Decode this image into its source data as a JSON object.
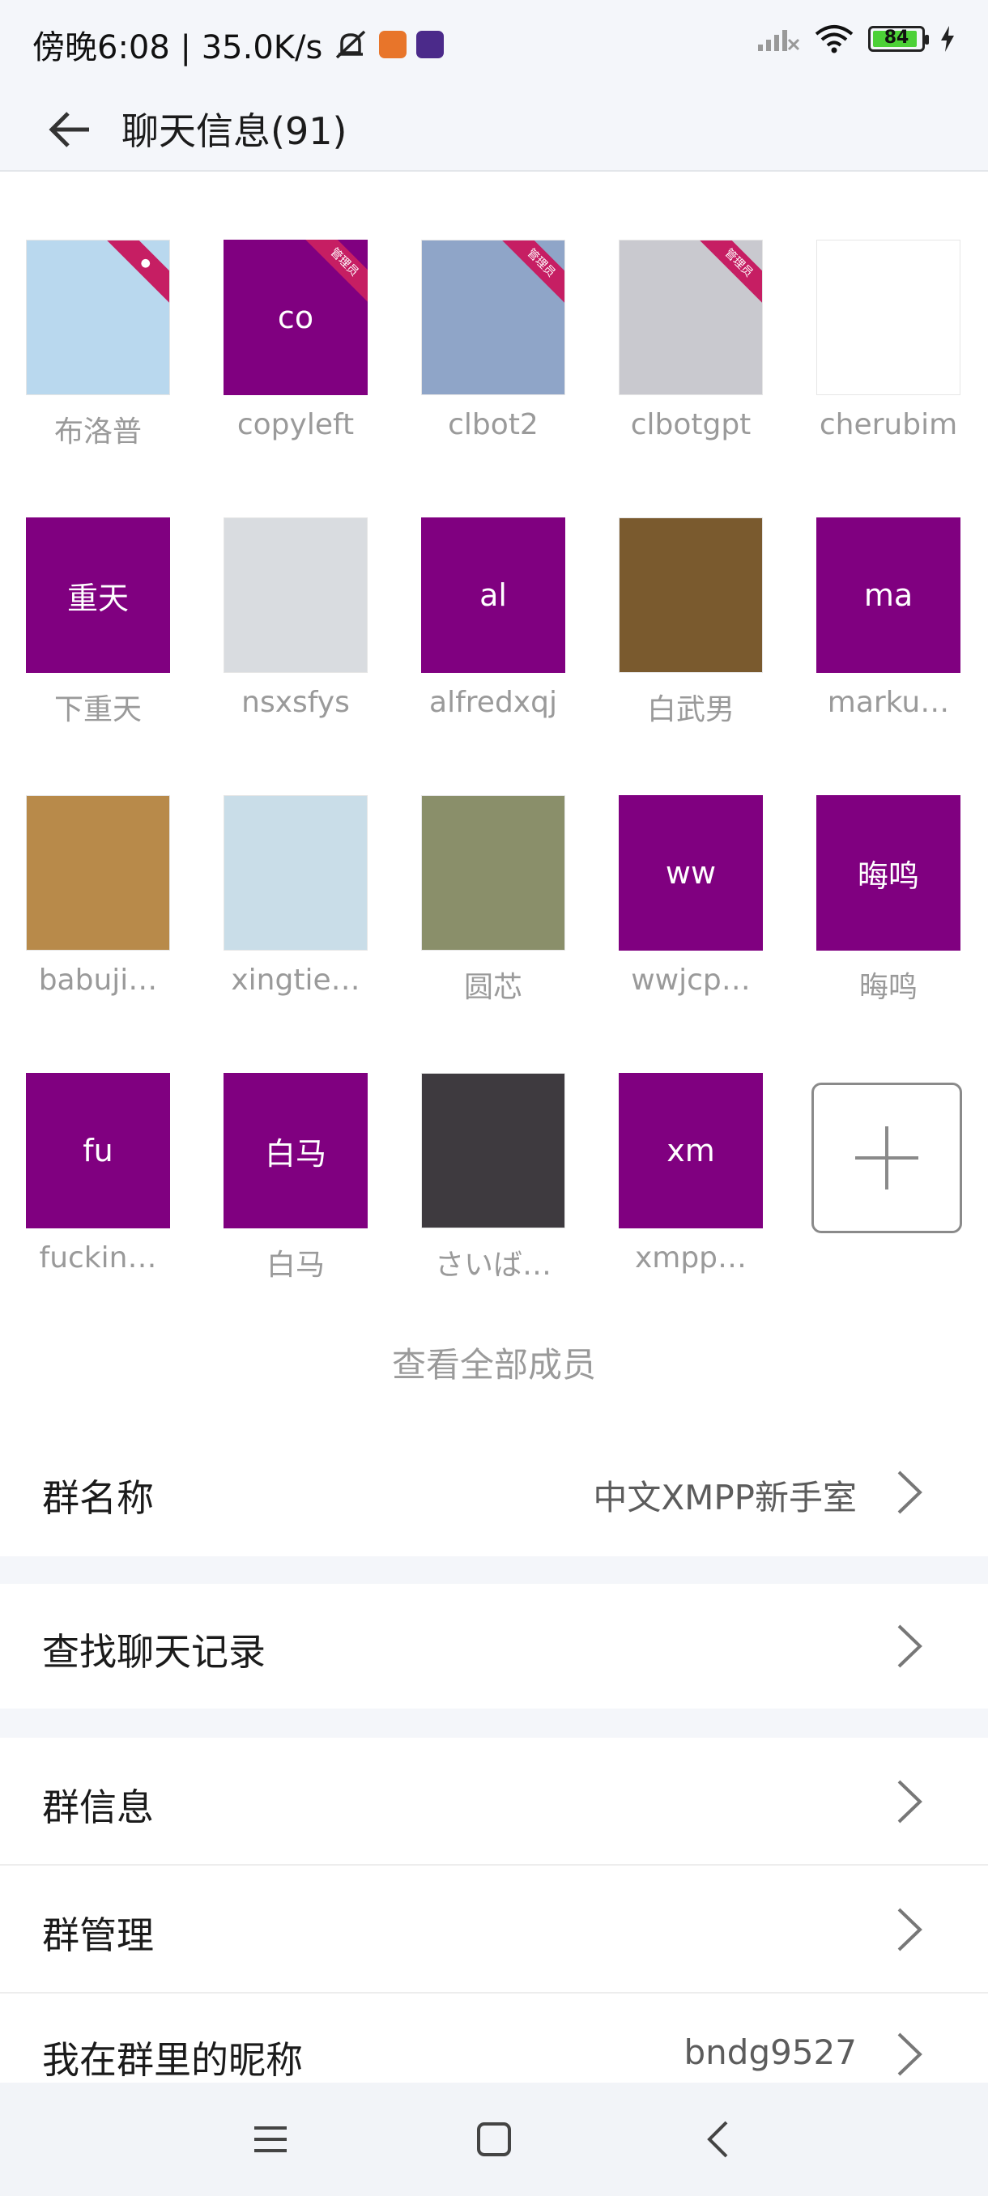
{
  "status": {
    "time_speed": "傍晚6:08 | 35.0K/s",
    "battery": "84"
  },
  "header": {
    "title": "聊天信息(91)"
  },
  "members": [
    {
      "name": "布洛普",
      "avatar_text": "",
      "style": "image",
      "color": "#b9d8ee",
      "badge": "person"
    },
    {
      "name": "copyleft",
      "avatar_text": "co",
      "style": "purple",
      "badge": "admin"
    },
    {
      "name": "clbot2",
      "avatar_text": "",
      "style": "image",
      "color": "#8fa5c8",
      "badge": "admin"
    },
    {
      "name": "clbotgpt",
      "avatar_text": "",
      "style": "image",
      "color": "#c9c9cf",
      "badge": "admin"
    },
    {
      "name": "cherubim",
      "avatar_text": "",
      "style": "image",
      "color": "#ffffff",
      "badge": ""
    },
    {
      "name": "下重天",
      "avatar_text": "重天",
      "style": "purple",
      "badge": ""
    },
    {
      "name": "nsxsfys",
      "avatar_text": "",
      "style": "image",
      "color": "#d9dce0",
      "badge": ""
    },
    {
      "name": "alfredxqj",
      "avatar_text": "al",
      "style": "purple",
      "badge": ""
    },
    {
      "name": "白武男",
      "avatar_text": "",
      "style": "image",
      "color": "#7a5a2e",
      "badge": ""
    },
    {
      "name": "marku…",
      "avatar_text": "ma",
      "style": "purple",
      "badge": ""
    },
    {
      "name": "babuji…",
      "avatar_text": "",
      "style": "image",
      "color": "#b88a4a",
      "badge": ""
    },
    {
      "name": "xingtie…",
      "avatar_text": "",
      "style": "image",
      "color": "#c9dde8",
      "badge": ""
    },
    {
      "name": "圆芯",
      "avatar_text": "",
      "style": "image",
      "color": "#8a8f6a",
      "badge": ""
    },
    {
      "name": "wwjcp…",
      "avatar_text": "ww",
      "style": "purple",
      "badge": ""
    },
    {
      "name": "晦鸣",
      "avatar_text": "晦鸣",
      "style": "purple",
      "badge": ""
    },
    {
      "name": "fuckin…",
      "avatar_text": "fu",
      "style": "purple",
      "badge": ""
    },
    {
      "name": "白马",
      "avatar_text": "白马",
      "style": "purple",
      "badge": ""
    },
    {
      "name": "さいば…",
      "avatar_text": "",
      "style": "image",
      "color": "#3e3a3f",
      "badge": ""
    },
    {
      "name": "xmpp…",
      "avatar_text": "xm",
      "style": "purple",
      "badge": ""
    }
  ],
  "badges": {
    "admin": "管理员"
  },
  "view_all": "查看全部成员",
  "settings": {
    "group_name_label": "群名称",
    "group_name_value": "中文XMPP新手室",
    "search_history_label": "查找聊天记录",
    "group_info_label": "群信息",
    "group_manage_label": "群管理",
    "my_nickname_label": "我在群里的昵称",
    "my_nickname_value": "bndg9527"
  }
}
